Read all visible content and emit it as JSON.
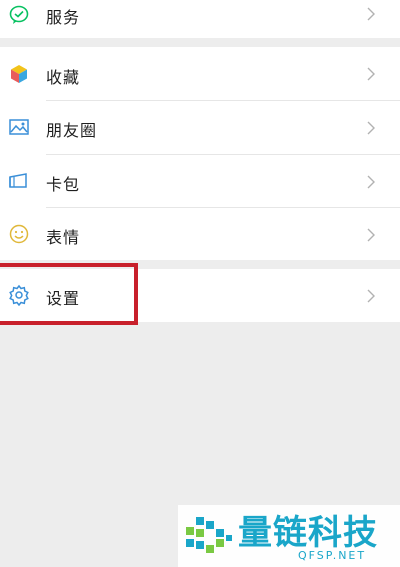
{
  "menu": {
    "services": {
      "label": "服务",
      "icon": "services-icon"
    },
    "favorites": {
      "label": "收藏",
      "icon": "favorites-cube-icon"
    },
    "moments": {
      "label": "朋友圈",
      "icon": "moments-image-icon"
    },
    "cards": {
      "label": "卡包",
      "icon": "card-wallet-icon"
    },
    "stickers": {
      "label": "表情",
      "icon": "smiley-icon"
    },
    "settings": {
      "label": "设置",
      "icon": "gear-icon"
    }
  },
  "watermark": {
    "title": "量链科技",
    "subtitle": "QFSP.NET"
  },
  "colors": {
    "accent_green": "#07c160",
    "highlight_red": "#c8202b",
    "watermark_blue": "#1aa6c9",
    "background": "#ededed"
  }
}
